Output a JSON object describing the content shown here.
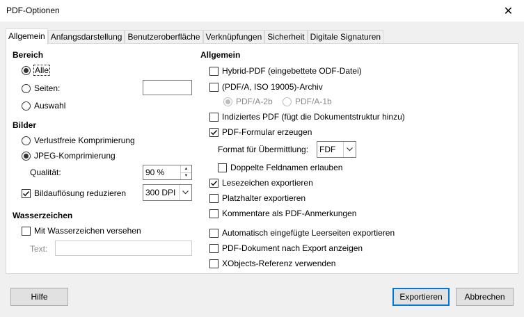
{
  "window": {
    "title": "PDF-Optionen",
    "close_glyph": "✕"
  },
  "tabs": [
    {
      "label": "Allgemein",
      "active": true
    },
    {
      "label": "Anfangsdarstellung"
    },
    {
      "label": "Benutzeroberfläche"
    },
    {
      "label": "Verknüpfungen"
    },
    {
      "label": "Sicherheit"
    },
    {
      "label": "Digitale Signaturen"
    }
  ],
  "bereich": {
    "heading": "Bereich",
    "alle": "Alle",
    "seiten": "Seiten:",
    "auswahl": "Auswahl"
  },
  "bilder": {
    "heading": "Bilder",
    "verlustfrei": "Verlustfreie Komprimierung",
    "jpeg": "JPEG-Komprimierung",
    "qualitaet_label": "Qualität:",
    "qualitaet_value": "90 %",
    "aufloesung_label": "Bildauflösung reduzieren",
    "aufloesung_value": "300 DPI"
  },
  "wasserzeichen": {
    "heading": "Wasserzeichen",
    "mit": "Mit Wasserzeichen versehen",
    "text_label": "Text:"
  },
  "allgemein": {
    "heading": "Allgemein",
    "hybrid": "Hybrid-PDF (eingebettete ODF-Datei)",
    "pdfa": "(PDF/A, ISO 19005)-Archiv",
    "pdfa2b": "PDF/A-2b",
    "pdfa1b": "PDF/A-1b",
    "indiziert": "Indiziertes PDF (fügt die Dokumentstruktur hinzu)",
    "formular": "PDF-Formular erzeugen",
    "format_label": "Format für Übermittlung:",
    "format_value": "FDF",
    "doppelt": "Doppelte Feldnamen erlauben",
    "lesezeichen": "Lesezeichen exportieren",
    "platzhalter": "Platzhalter exportieren",
    "kommentare": "Kommentare als PDF-Anmerkungen",
    "leerseiten": "Automatisch eingefügte Leerseiten exportieren",
    "anzeigen": "PDF-Dokument nach Export anzeigen",
    "xobjects": "XObjects-Referenz verwenden"
  },
  "buttons": {
    "hilfe": "Hilfe",
    "exportieren": "Exportieren",
    "abbrechen": "Abbrechen"
  }
}
